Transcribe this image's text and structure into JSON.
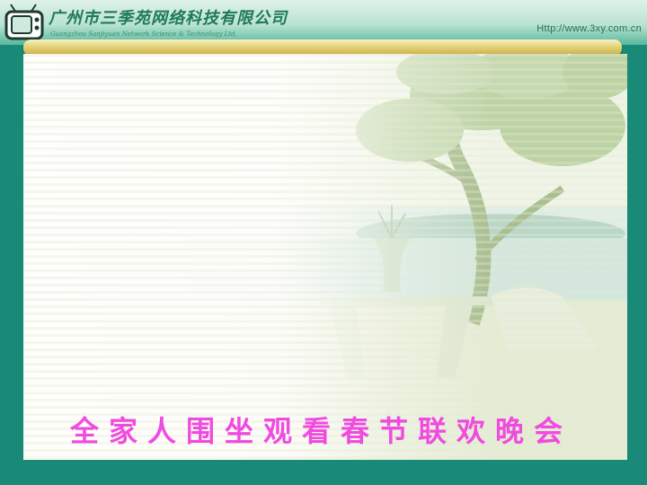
{
  "header": {
    "company_cn": "广州市三季苑网络科技有限公司",
    "company_en": "Guangzhou Sanjiyuan Network Science & Technology Ltd.",
    "url": "Http://www.3xy.com.cn",
    "logo_icon": "tv-logo-icon"
  },
  "slide": {
    "title": "全家人围坐观看春节联欢晚会"
  },
  "colors": {
    "frame": "#188a77",
    "scroll": "#e6d67e",
    "title_text": "#f04be0"
  }
}
